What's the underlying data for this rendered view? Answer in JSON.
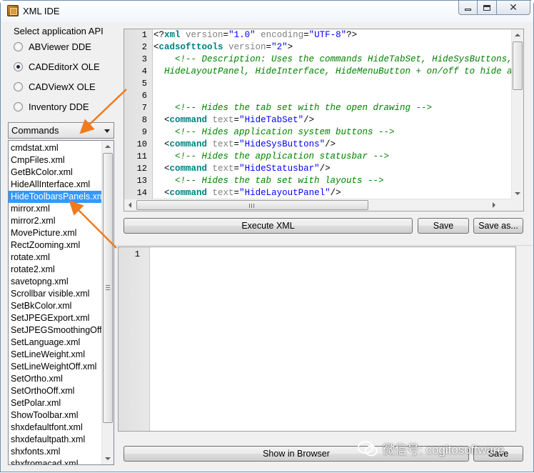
{
  "window": {
    "title": "XML IDE"
  },
  "api": {
    "title": "Select application API",
    "options": [
      {
        "label": "ABViewer DDE",
        "checked": false
      },
      {
        "label": "CADEditorX OLE",
        "checked": true
      },
      {
        "label": "CADViewX OLE",
        "checked": false
      },
      {
        "label": "Inventory DDE",
        "checked": false
      }
    ]
  },
  "commands_combo": {
    "selected": "Commands"
  },
  "file_list": {
    "items": [
      "cmdstat.xml",
      "CmpFiles.xml",
      "GetBkColor.xml",
      "HideAllInterface.xml",
      "HideToolbarsPanels.xml",
      "mirror.xml",
      "mirror2.xml",
      "MovePicture.xml",
      "RectZooming.xml",
      "rotate.xml",
      "rotate2.xml",
      "savetopng.xml",
      "Scrollbar visible.xml",
      "SetBkColor.xml",
      "SetJPEGExport.xml",
      "SetJPEGSmoothingOff.xml",
      "SetLanguage.xml",
      "SetLineWeight.xml",
      "SetLineWeightOff.xml",
      "SetOrtho.xml",
      "SetOrthoOff.xml",
      "SetPolar.xml",
      "ShowToolbar.xml",
      "shxdefaultfont.xml",
      "shxdefaultpath.xml",
      "shxfonts.xml",
      "shxfromacad.xml"
    ],
    "selected": "HideToolbarsPanels.xml"
  },
  "editor": {
    "line_numbers": [
      "1",
      "2",
      "3",
      "4",
      "5",
      "6",
      "7",
      "8",
      "9",
      "10",
      "11",
      "12",
      "13",
      "14"
    ],
    "lines": [
      [
        [
          "#000000",
          "<?"
        ],
        [
          "#008080",
          "xml"
        ],
        [
          "#808080",
          " version"
        ],
        [
          "#000000",
          "="
        ],
        [
          "#0000ff",
          "\"1.0\""
        ],
        [
          "#808080",
          " encoding"
        ],
        [
          "#000000",
          "="
        ],
        [
          "#0000ff",
          "\"UTF-8\""
        ],
        [
          "#000000",
          "?>"
        ]
      ],
      [
        [
          "#000000",
          "<"
        ],
        [
          "#008080",
          "cadsofttools"
        ],
        [
          "#808080",
          " version"
        ],
        [
          "#000000",
          "="
        ],
        [
          "#0000ff",
          "\"2\""
        ],
        [
          "#000000",
          ">"
        ]
      ],
      [
        [
          "#008000",
          "    <!-- Description: Uses the commands HideTabSet, HideSysButtons, HideStatusbar,"
        ]
      ],
      [
        [
          "#008000",
          "  HideLayoutPanel, HideInterface, HideMenuButton + on/off to hide and show them. -->"
        ]
      ],
      [
        [
          "#000000",
          ""
        ]
      ],
      [
        [
          "#000000",
          ""
        ]
      ],
      [
        [
          "#008000",
          "    <!-- Hides the tab set with the open drawing -->"
        ]
      ],
      [
        [
          "#000000",
          "  <"
        ],
        [
          "#008080",
          "command"
        ],
        [
          "#808080",
          " text"
        ],
        [
          "#000000",
          "="
        ],
        [
          "#0000ff",
          "\"HideTabSet\""
        ],
        [
          "#000000",
          "/>"
        ]
      ],
      [
        [
          "#008000",
          "    <!-- Hides application system buttons -->"
        ]
      ],
      [
        [
          "#000000",
          "  <"
        ],
        [
          "#008080",
          "command"
        ],
        [
          "#808080",
          " text"
        ],
        [
          "#000000",
          "="
        ],
        [
          "#0000ff",
          "\"HideSysButtons\""
        ],
        [
          "#000000",
          "/>"
        ]
      ],
      [
        [
          "#008000",
          "    <!-- Hides the application statusbar -->"
        ]
      ],
      [
        [
          "#000000",
          "  <"
        ],
        [
          "#008080",
          "command"
        ],
        [
          "#808080",
          " text"
        ],
        [
          "#000000",
          "="
        ],
        [
          "#0000ff",
          "\"HideStatusbar\""
        ],
        [
          "#000000",
          "/>"
        ]
      ],
      [
        [
          "#008000",
          "    <!-- Hides the tab set with layouts -->"
        ]
      ],
      [
        [
          "#000000",
          "  <"
        ],
        [
          "#008080",
          "command"
        ],
        [
          "#808080",
          " text"
        ],
        [
          "#000000",
          "="
        ],
        [
          "#0000ff",
          "\"HideLayoutPanel\""
        ],
        [
          "#000000",
          "/>"
        ]
      ]
    ]
  },
  "buttons": {
    "execute": "Execute XML",
    "save": "Save",
    "save_as": "Save as...",
    "show_in_browser": "Show in Browser",
    "save_bottom": "Save"
  },
  "output": {
    "line_numbers": [
      "1"
    ]
  },
  "watermark": {
    "text": "微信号: cogitosoftware"
  },
  "colors": {
    "selection": "#3399ff",
    "arrow": "#f07a1e"
  }
}
